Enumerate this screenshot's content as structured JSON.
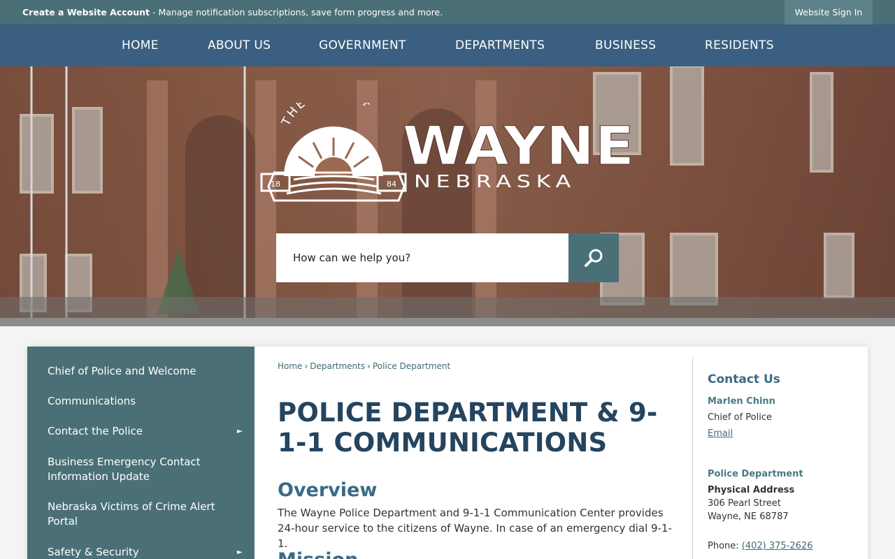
{
  "topbar": {
    "account_link": "Create a Website Account",
    "account_message": " - Manage notification subscriptions, save form progress and more.",
    "signin": "Website Sign In"
  },
  "nav": {
    "items": [
      "HOME",
      "ABOUT US",
      "GOVERNMENT",
      "DEPARTMENTS",
      "BUSINESS",
      "RESIDENTS"
    ]
  },
  "logo": {
    "arc_text": "THE CITY OF",
    "name": "WAYNE",
    "state": "NEBRASKA",
    "year_left": "18",
    "year_right": "84"
  },
  "search": {
    "placeholder": "How can we help you?",
    "icon": "search-icon"
  },
  "sidebar": {
    "items": [
      {
        "label": "Chief of Police and Welcome",
        "has_submenu": false
      },
      {
        "label": "Communications",
        "has_submenu": false
      },
      {
        "label": "Contact the Police",
        "has_submenu": true
      },
      {
        "label": "Business Emergency Contact Information Update",
        "has_submenu": false
      },
      {
        "label": "Nebraska Victims of Crime Alert Portal",
        "has_submenu": false
      },
      {
        "label": "Safety & Security",
        "has_submenu": true
      }
    ],
    "submenu_arrow": "►"
  },
  "breadcrumb": {
    "items": [
      "Home",
      "Departments",
      "Police Department"
    ],
    "separator": "›"
  },
  "main": {
    "title": "POLICE DEPARTMENT & 9-1-1 COMMUNICATIONS",
    "overview_heading": "Overview",
    "overview_text": "The Wayne Police Department and 9-1-1 Communication Center provides 24-hour service to the citizens of Wayne. In case of an emergency dial 9-1-1.",
    "mission_heading": "Mission"
  },
  "contact": {
    "title": "Contact Us",
    "person_name": "Marlen Chinn",
    "person_title": "Chief of Police",
    "email_label": "Email",
    "dept_name": "Police Department",
    "address_label": "Physical Address",
    "address_line1": "306 Pearl Street",
    "address_line2": "Wayne, NE 68787",
    "phone_label": "Phone: ",
    "phone": "(402) 375-2626"
  },
  "colors": {
    "topbar": "#4a6f76",
    "nav": "#3a5f80",
    "sidebar": "#4a6f76",
    "title": "#25445e",
    "heading": "#3a6a86"
  }
}
